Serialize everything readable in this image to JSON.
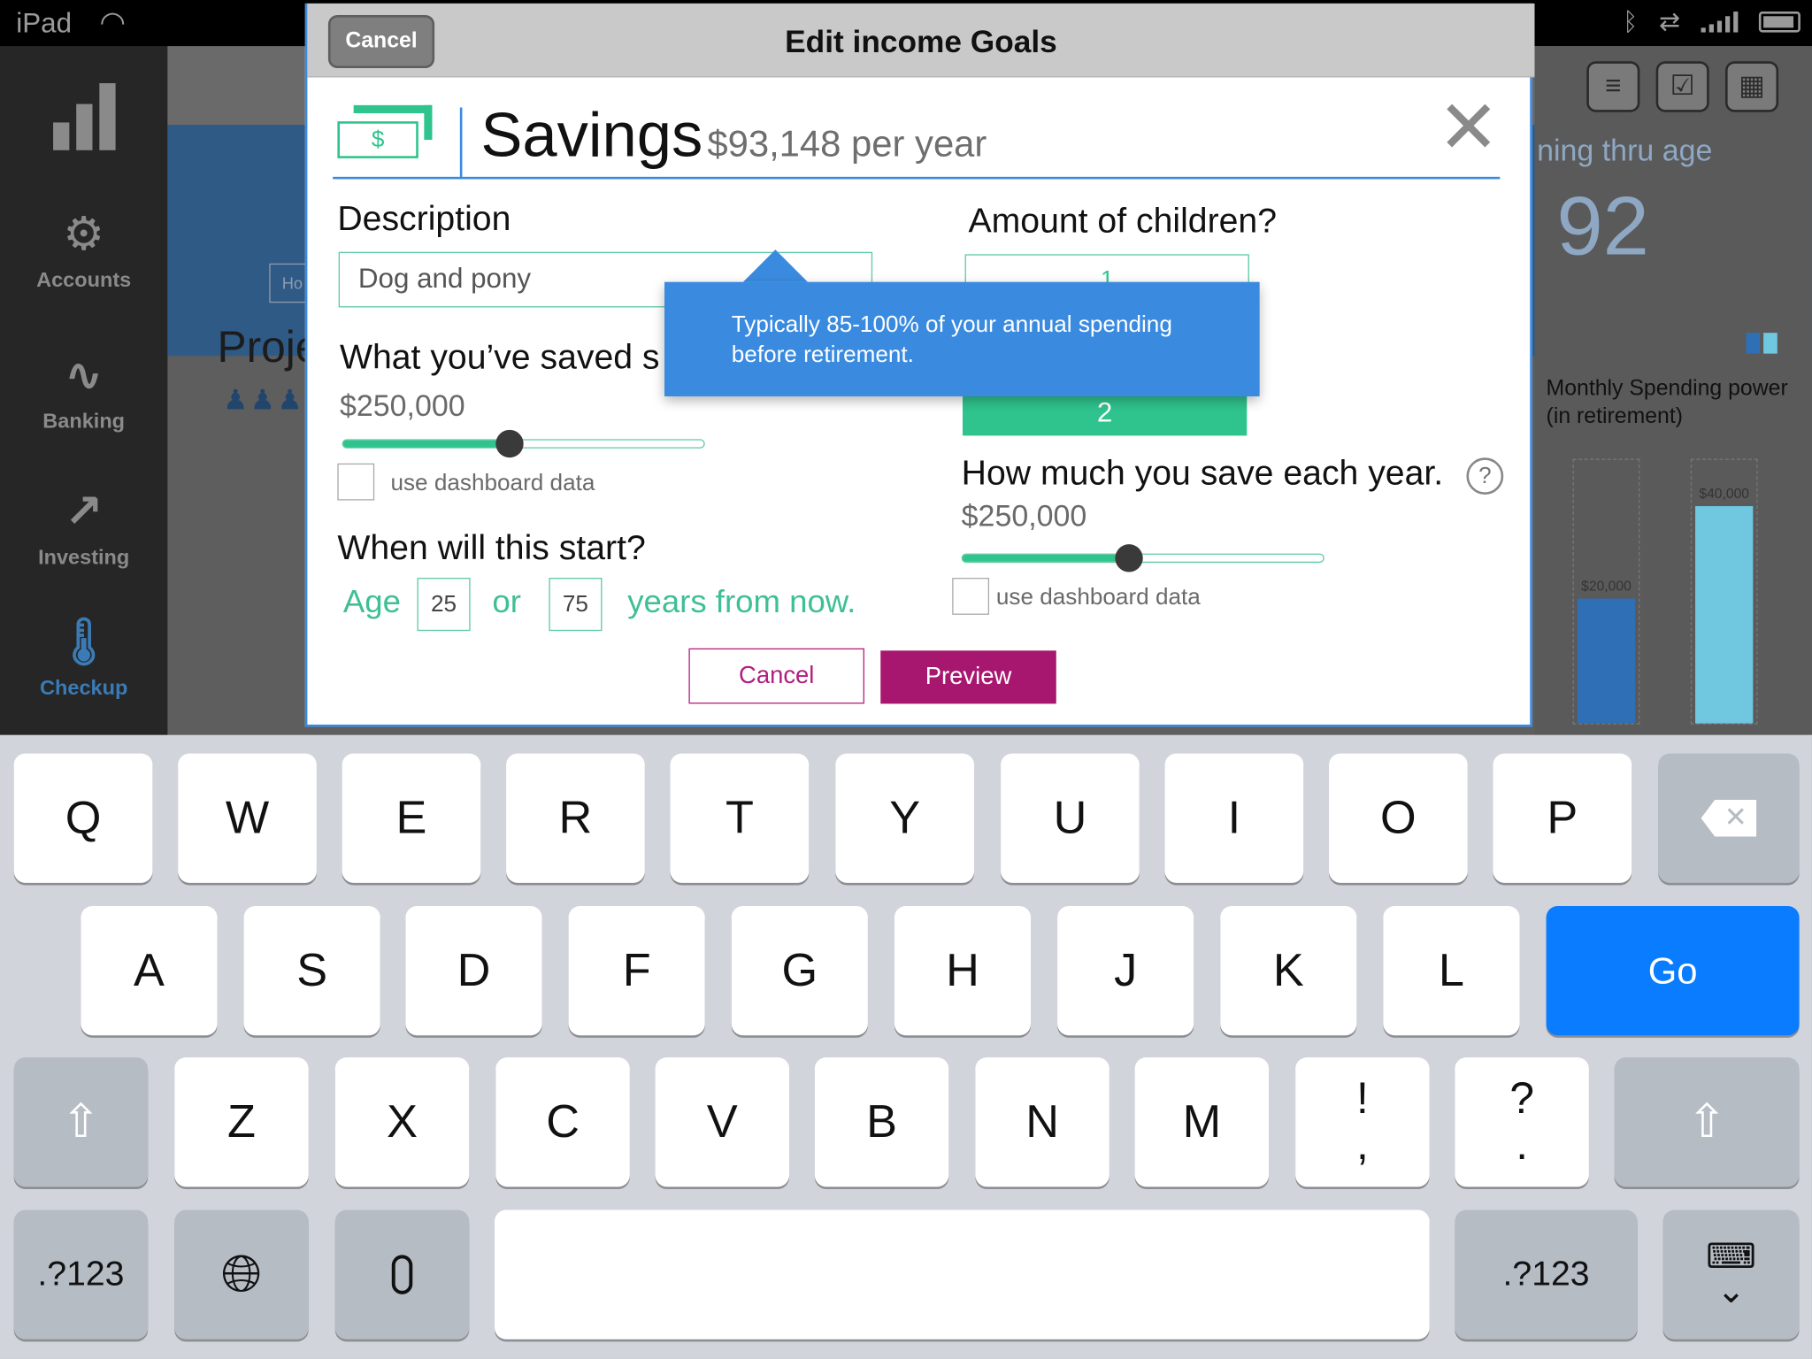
{
  "status_bar": {
    "device": "iPad"
  },
  "sidebar": {
    "items": [
      {
        "label": ""
      },
      {
        "label": "Accounts"
      },
      {
        "label": "Banking"
      },
      {
        "label": "Investing"
      },
      {
        "label": "Checkup"
      }
    ]
  },
  "background": {
    "age_label": "ning thru age",
    "age_value": "92",
    "projection_title": "Proje",
    "ho_button": "Ho",
    "spending_title_line1": "Monthly Spending power",
    "spending_title_line2": "(in retirement)",
    "bar1_label": "$20,000",
    "bar2_label": "$40,000",
    "legend_colors": [
      "#2f6fb5",
      "#6fc7e0"
    ]
  },
  "modal": {
    "cancel_label": "Cancel",
    "title": "Edit income Goals",
    "icon_symbol": "$",
    "goal_name": "Savings",
    "goal_amount": "$93,148 per year",
    "close_symbol": "✕",
    "description_label": "Description",
    "description_value": "Dog and pony",
    "saved_label": "What you’ve saved s",
    "saved_value": "$250,000",
    "saved_slider_fraction": 0.46,
    "use_dashboard_label": "use dashboard data",
    "start_label": "When will this start?",
    "age_word": "Age",
    "age_value": "25",
    "or_word": "or",
    "years_value": "75",
    "years_suffix": "years from now.",
    "children_label": "Amount of children?",
    "children_selected": "1",
    "children_option_2": "2",
    "save_each_year_label": "How much you save each year.",
    "help_symbol": "?",
    "save_each_year_value": "$250,000",
    "save_slider_fraction": 0.46,
    "use_dashboard_label_2": "use dashboard data",
    "cancel_button": "Cancel",
    "preview_button": "Preview",
    "tooltip_text": "Typically 85-100% of your annual spending before retirement.",
    "accent_color": "#2fc48e",
    "brand_color": "#a8176f"
  },
  "keyboard": {
    "row1": [
      "Q",
      "W",
      "E",
      "R",
      "T",
      "Y",
      "U",
      "I",
      "O",
      "P"
    ],
    "row2": [
      "A",
      "S",
      "D",
      "F",
      "G",
      "H",
      "J",
      "K",
      "L"
    ],
    "row3": [
      "Z",
      "X",
      "C",
      "V",
      "B",
      "N",
      "M"
    ],
    "excl_top": "!",
    "excl_bottom": ",",
    "quest_top": "?",
    "quest_bottom": ".",
    "go_label": "Go",
    "numbers_label": ".?123"
  }
}
